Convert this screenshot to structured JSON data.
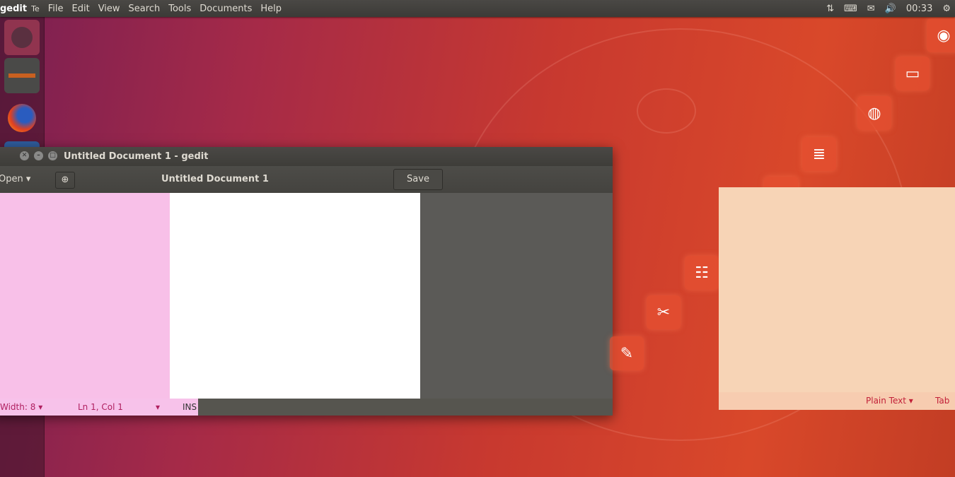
{
  "top_panel": {
    "app_name": "gedit",
    "window_indicator": "Te",
    "menu": [
      "File",
      "Edit",
      "View",
      "Search",
      "Tools",
      "Documents",
      "Help"
    ],
    "clock": "00:33",
    "indicator_icons": [
      "transfer-icon",
      "keyboard-icon",
      "mail-icon",
      "volume-icon",
      "settings-icon"
    ]
  },
  "launcher": {
    "items": [
      "ubuntu-dash-icon",
      "files-icon",
      "firefox-icon",
      "libreoffice-writer-icon",
      "libreoffice-calc-icon",
      "libreoffice-impress-icon",
      "software-center-icon",
      "system-settings-icon",
      "text-editor-icon"
    ]
  },
  "gedit": {
    "window_title": "Untitled Document 1 - gedit",
    "open_label": "Open",
    "doc_title": "Untitled Document 1",
    "save_label": "Save",
    "status": {
      "tab_width": "Width: 8",
      "position": "Ln 1, Col 1",
      "mode": "INS"
    }
  },
  "dash_status": {
    "language": "Plain Text",
    "tab": "Tab"
  }
}
